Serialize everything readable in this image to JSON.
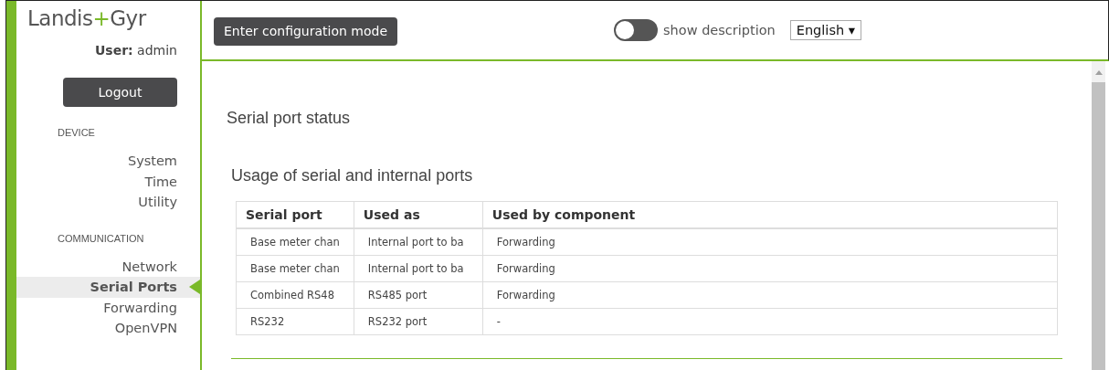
{
  "logo": {
    "text_before": "Landis",
    "plus": "+",
    "text_after": "Gyr"
  },
  "user": {
    "label": "User:",
    "name": "admin"
  },
  "logout_button": "Logout",
  "nav": [
    {
      "heading": "DEVICE",
      "items": [
        {
          "label": "System",
          "selected": false
        },
        {
          "label": "Time",
          "selected": false
        },
        {
          "label": "Utility",
          "selected": false
        }
      ]
    },
    {
      "heading": "COMMUNICATION",
      "items": [
        {
          "label": "Network",
          "selected": false
        },
        {
          "label": "Serial Ports",
          "selected": true
        },
        {
          "label": "Forwarding",
          "selected": false
        },
        {
          "label": "OpenVPN",
          "selected": false
        }
      ]
    }
  ],
  "header": {
    "config_button": "Enter configuration mode",
    "description_toggle": {
      "label": "show description",
      "on": false
    },
    "language": "English ▾"
  },
  "page_title": "Serial port status",
  "section_title": "Usage of serial and internal ports",
  "table": {
    "columns": [
      "Serial port",
      "Used as",
      "Used by component"
    ],
    "rows": [
      [
        "Base meter chan",
        "Internal port to ba",
        "Forwarding"
      ],
      [
        "Base meter chan",
        "Internal port to ba",
        "Forwarding"
      ],
      [
        "Combined RS48",
        "RS485 port",
        "Forwarding"
      ],
      [
        "RS232",
        "RS232 port",
        "-"
      ]
    ]
  }
}
